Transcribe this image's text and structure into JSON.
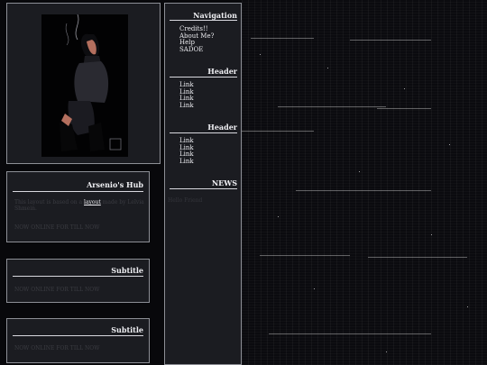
{
  "portrait": {
    "caption": ""
  },
  "hub": {
    "title": "Arsenio's Hub",
    "text_before": "This layout is based on a ",
    "link_label": "layout",
    "text_after": " made by Lelvia Shmein.",
    "footer_text": "NOW ONLINE FOR TILL NOW"
  },
  "subtitle_boxes": [
    {
      "title": "Subtitle",
      "text": "NOW ONLINE FOR TILL NOW"
    },
    {
      "title": "Subtitle",
      "text": "NOW ONLINE FOR TILL NOW"
    }
  ],
  "sidebar": {
    "navigation": {
      "title": "Navigation",
      "items": [
        "Credits!!",
        "About Me?",
        "Help",
        "SADOE"
      ]
    },
    "header1": {
      "title": "Header",
      "items": [
        "Link",
        "Link",
        "Link",
        "Link"
      ]
    },
    "header2": {
      "title": "Header",
      "items": [
        "Link",
        "Link",
        "Link",
        "Link"
      ]
    },
    "news": {
      "title": "NEWS",
      "ghost_text": "Hello Friend"
    }
  },
  "colors": {
    "background": "#08080b",
    "panel": "#1b1c21",
    "border": "#8d8f96",
    "text": "#f0f0f4",
    "dim_text": "#3b3c42"
  }
}
